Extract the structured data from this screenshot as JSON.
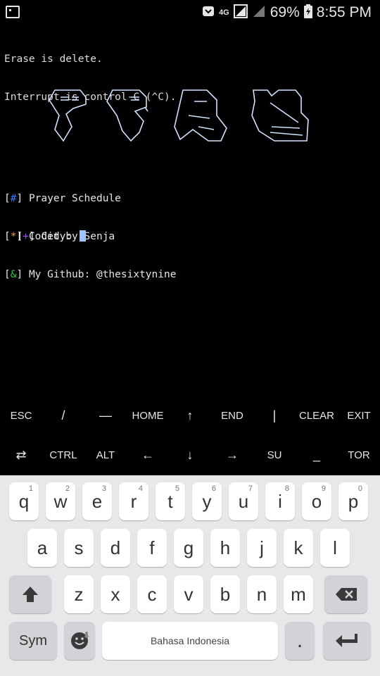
{
  "status_bar": {
    "network_type": "4G",
    "battery_percent": "69%",
    "time": "8:55 PM",
    "icons": [
      "notification-icon",
      "pocket-icon",
      "signal-icon",
      "signal-icon",
      "battery-icon"
    ]
  },
  "terminal": {
    "line1": "Erase is delete.",
    "line2": "Interrupt is control-C (^C).",
    "banner_lines": [
      " ___   ___   ____   ___ _",
      "/ == \\/ == \\ / __ \\ /\\ \\_\\",
      "\\ \\ _-/\\ \\__< \\ \\ _ \\\\ \\____\\",
      " \\_\\/  \\_\\/ /_/ \\/_/ \\/\\_\\/ \\/_____/"
    ],
    "info": [
      {
        "mark": "#",
        "text": "Prayer Schedule"
      },
      {
        "mark": "*",
        "text": "Coded by Senja"
      },
      {
        "mark": "&",
        "text": "My Github: @thesixtynine"
      }
    ],
    "prompt_mark": "+",
    "prompt_label": "City:",
    "prompt_value": ""
  },
  "extra_keys": {
    "row1": [
      "ESC",
      "/",
      "—",
      "HOME",
      "↑",
      "END",
      "|",
      "CLEAR",
      "EXIT"
    ],
    "row2": [
      "⇄",
      "CTRL",
      "ALT",
      "←",
      "↓",
      "→",
      "SU",
      "_",
      "TOR"
    ]
  },
  "keyboard": {
    "row1": [
      {
        "k": "q",
        "h": "1"
      },
      {
        "k": "w",
        "h": "2"
      },
      {
        "k": "e",
        "h": "3"
      },
      {
        "k": "r",
        "h": "4"
      },
      {
        "k": "t",
        "h": "5"
      },
      {
        "k": "y",
        "h": "6"
      },
      {
        "k": "u",
        "h": "7"
      },
      {
        "k": "i",
        "h": "8"
      },
      {
        "k": "o",
        "h": "9"
      },
      {
        "k": "p",
        "h": "0"
      }
    ],
    "row2": [
      "a",
      "s",
      "d",
      "f",
      "g",
      "h",
      "j",
      "k",
      "l"
    ],
    "row3": [
      "z",
      "x",
      "c",
      "v",
      "b",
      "n",
      "m"
    ],
    "sym_label": "Sym",
    "space_label": "Bahasa Indonesia",
    "period_label": "."
  }
}
